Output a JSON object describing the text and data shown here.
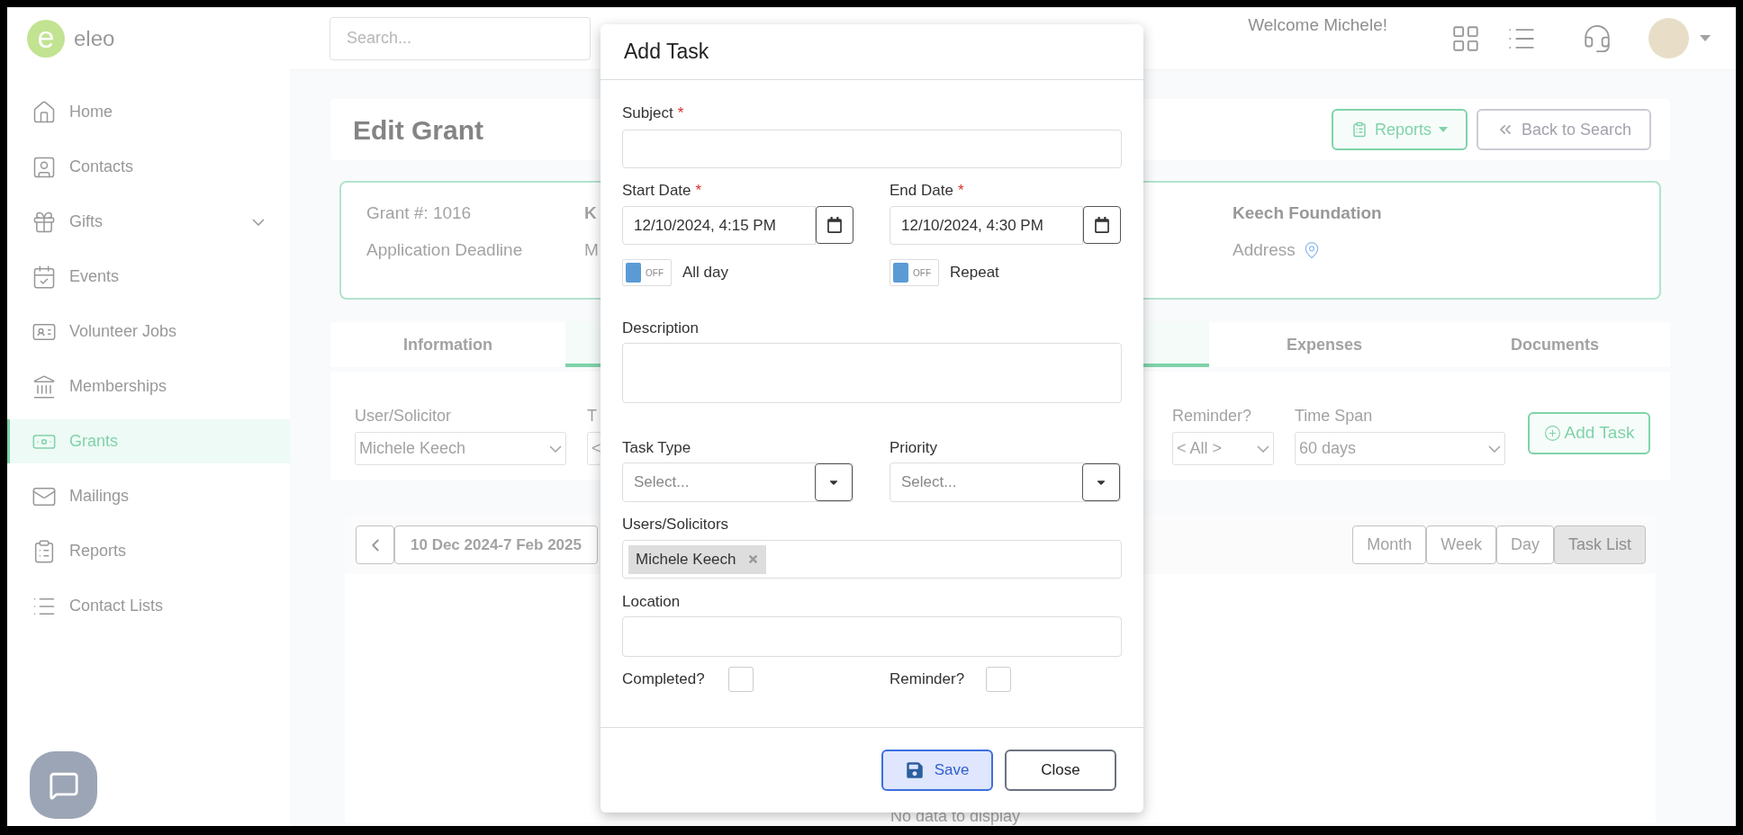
{
  "sidebar": {
    "logo_letter": "e",
    "logo_text": "eleo",
    "items": [
      {
        "label": "Home",
        "selected": false,
        "has_submenu": false
      },
      {
        "label": "Contacts",
        "selected": false,
        "has_submenu": false
      },
      {
        "label": "Gifts",
        "selected": false,
        "has_submenu": true
      },
      {
        "label": "Events",
        "selected": false,
        "has_submenu": false
      },
      {
        "label": "Volunteer Jobs",
        "selected": false,
        "has_submenu": false
      },
      {
        "label": "Memberships",
        "selected": false,
        "has_submenu": false
      },
      {
        "label": "Grants",
        "selected": true,
        "has_submenu": false
      },
      {
        "label": "Mailings",
        "selected": false,
        "has_submenu": false
      },
      {
        "label": "Reports",
        "selected": false,
        "has_submenu": false
      },
      {
        "label": "Contact Lists",
        "selected": false,
        "has_submenu": false
      }
    ]
  },
  "top_bar": {
    "search": {
      "placeholder": "Search..."
    },
    "welcome": "Welcome Michele!"
  },
  "page": {
    "title": "Edit Grant",
    "buttons": [
      {
        "kind": "reports",
        "label": "Reports"
      },
      {
        "kind": "back",
        "label": "Back to Search"
      }
    ],
    "grant_card": {
      "column_1": [
        "Grant #: 1016",
        "Application Deadline"
      ],
      "column_2": [
        "K",
        "M"
      ],
      "organization": "Keech Foundation",
      "address_label": "Address"
    },
    "tabs": [
      {
        "label": "Information",
        "selected": false
      },
      {
        "selected": true
      },
      {
        "label": "Expenses",
        "selected": false
      },
      {
        "label": "Documents",
        "selected": false
      }
    ],
    "filters": [
      {
        "label": "User/Solicitor",
        "value": "Michele Keech"
      },
      {
        "label": "T",
        "value": "<"
      },
      {
        "label": "Reminder?",
        "value": "< All >"
      },
      {
        "label": "Time Span",
        "value": "60 days"
      }
    ],
    "add_task_button": "Add Task",
    "date_range": "10 Dec 2024-7 Feb 2025",
    "views": [
      {
        "label": "Month",
        "selected": false
      },
      {
        "label": "Week",
        "selected": false
      },
      {
        "label": "Day",
        "selected": false
      },
      {
        "label": "Task List",
        "selected": true
      }
    ],
    "empty_message": "No data to display"
  },
  "dialog": {
    "title": "Add Task",
    "subject": {
      "label": "Subject",
      "required_mark": "*"
    },
    "start_date": {
      "label": "Start Date",
      "required_mark": "*",
      "value": "12/10/2024, 4:15 PM"
    },
    "end_date": {
      "label": "End Date",
      "required_mark": "*",
      "value": "12/10/2024, 4:30 PM"
    },
    "toggles": [
      {
        "label": "All day",
        "on": false,
        "state_text": "OFF"
      },
      {
        "label": "Repeat",
        "on": false,
        "state_text": "OFF"
      }
    ],
    "description": {
      "label": "Description"
    },
    "selects": [
      {
        "label": "Task Type",
        "placeholder": "Select..."
      },
      {
        "label": "Priority",
        "placeholder": "Select..."
      }
    ],
    "users": {
      "label": "Users/Solicitors",
      "tags": [
        "Michele Keech"
      ]
    },
    "location": {
      "label": "Location"
    },
    "checkboxes": [
      {
        "label": "Completed?",
        "checked": false
      },
      {
        "label": "Reminder?",
        "checked": false
      }
    ],
    "buttons": [
      {
        "kind": "save",
        "label": "Save"
      },
      {
        "kind": "close",
        "label": "Close"
      }
    ]
  }
}
